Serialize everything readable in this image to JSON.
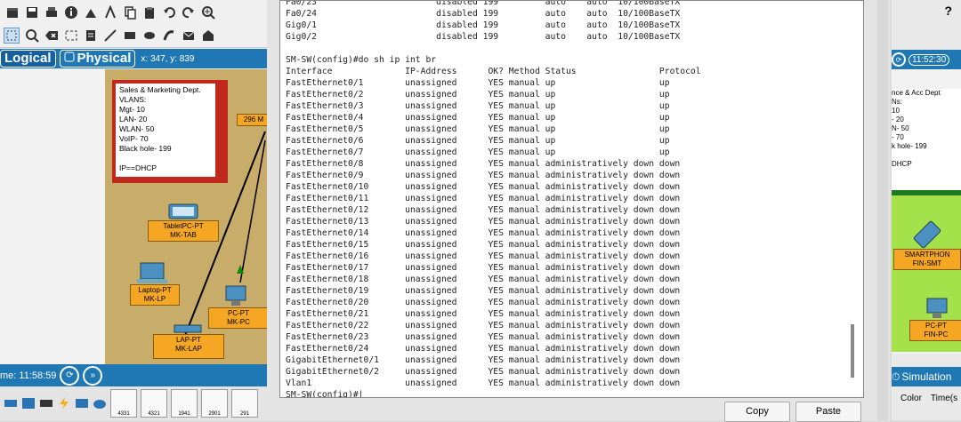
{
  "left": {
    "tabs": {
      "logical": "Logical",
      "physical": "Physical"
    },
    "coords": "x: 347, y: 839",
    "note": {
      "lines": [
        "Sales & Marketing Dept.",
        "VLANS:",
        "Mgt- 10",
        "LAN- 20",
        "WLAN- 50",
        "VoIP- 70",
        "Black hole- 199",
        "",
        "IP==DHCP"
      ]
    },
    "devices": {
      "tablet": "TabletPC-PT\nMK-TAB",
      "laptop": "Laptop-PT\nMK-LP",
      "pc": "PC-PT\nMK-PC",
      "lap": "LAP-PT\nMK-LAP",
      "switch": "296\nM"
    },
    "time": "me: 11:58:59",
    "device_models": [
      "4331",
      "4321",
      "1941",
      "2901",
      "291"
    ]
  },
  "terminal": {
    "lines": [
      "Fa0/23                       disabled 199         auto    auto  10/100BaseTX",
      "Fa0/24                       disabled 199         auto    auto  10/100BaseTX",
      "Gig0/1                       disabled 199         auto    auto  10/100BaseTX",
      "Gig0/2                       disabled 199         auto    auto  10/100BaseTX",
      "",
      "SM-SW(config)#do sh ip int br",
      "Interface              IP-Address      OK? Method Status                Protocol",
      "FastEthernet0/1        unassigned      YES manual up                    up",
      "FastEthernet0/2        unassigned      YES manual up                    up",
      "FastEthernet0/3        unassigned      YES manual up                    up",
      "FastEthernet0/4        unassigned      YES manual up                    up",
      "FastEthernet0/5        unassigned      YES manual up                    up",
      "FastEthernet0/6        unassigned      YES manual up                    up",
      "FastEthernet0/7        unassigned      YES manual up                    up",
      "FastEthernet0/8        unassigned      YES manual administratively down down",
      "FastEthernet0/9        unassigned      YES manual administratively down down",
      "FastEthernet0/10       unassigned      YES manual administratively down down",
      "FastEthernet0/11       unassigned      YES manual administratively down down",
      "FastEthernet0/12       unassigned      YES manual administratively down down",
      "FastEthernet0/13       unassigned      YES manual administratively down down",
      "FastEthernet0/14       unassigned      YES manual administratively down down",
      "FastEthernet0/15       unassigned      YES manual administratively down down",
      "FastEthernet0/16       unassigned      YES manual administratively down down",
      "FastEthernet0/17       unassigned      YES manual administratively down down",
      "FastEthernet0/18       unassigned      YES manual administratively down down",
      "FastEthernet0/19       unassigned      YES manual administratively down down",
      "FastEthernet0/20       unassigned      YES manual administratively down down",
      "FastEthernet0/21       unassigned      YES manual administratively down down",
      "FastEthernet0/22       unassigned      YES manual administratively down down",
      "FastEthernet0/23       unassigned      YES manual administratively down down",
      "FastEthernet0/24       unassigned      YES manual administratively down down",
      "GigabitEthernet0/1     unassigned      YES manual administratively down down",
      "GigabitEthernet0/2     unassigned      YES manual administratively down down",
      "Vlan1                  unassigned      YES manual administratively down down",
      "SM-SW(config)#"
    ],
    "copy_label": "Copy",
    "paste_label": "Paste"
  },
  "right": {
    "help": "?",
    "time": "11:52:30",
    "note_lines": [
      "nce & Acc Dept",
      "Ns:",
      "10",
      "- 20",
      "N- 50",
      "- 70",
      "k hole- 199",
      "",
      "DHCP"
    ],
    "devices": {
      "phone": "SMARTPHON\nFIN-SMT",
      "pc": "PC-PT\nFIN-PC"
    },
    "simulation": "Simulation",
    "col_color": "Color",
    "col_time": "Time(s"
  },
  "colors": {
    "accent": "#1f78b4",
    "note_red": "#c0281e",
    "area_tan": "#c7ac6a",
    "area_green": "#a4e14a",
    "device_label": "#f5a623"
  }
}
